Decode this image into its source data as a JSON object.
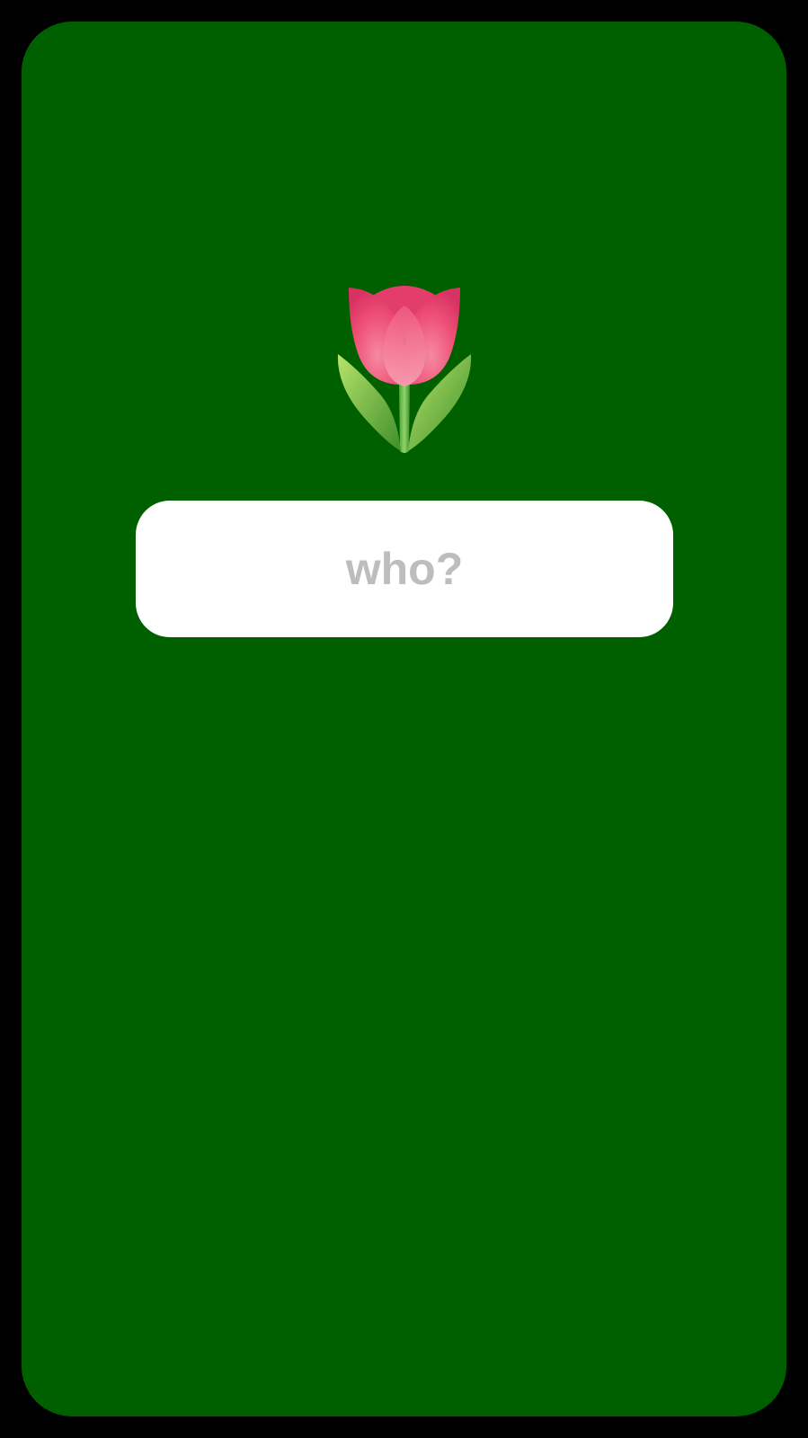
{
  "screen": {
    "background_color": "#006000",
    "frame_color": "#000000"
  },
  "emoji": {
    "icon": "tulip-icon",
    "glyph": "🌷"
  },
  "name_input": {
    "placeholder": "who?",
    "value": "",
    "background_color": "#ffffff",
    "placeholder_color": "#bdbdbd"
  }
}
